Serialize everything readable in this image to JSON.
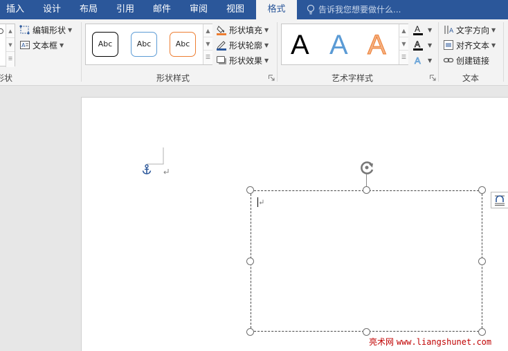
{
  "tabs": [
    {
      "label": "插入",
      "active": false
    },
    {
      "label": "设计",
      "active": false
    },
    {
      "label": "布局",
      "active": false
    },
    {
      "label": "引用",
      "active": false
    },
    {
      "label": "邮件",
      "active": false
    },
    {
      "label": "审阅",
      "active": false
    },
    {
      "label": "视图",
      "active": false
    },
    {
      "label": "格式",
      "active": true
    }
  ],
  "tell_me": {
    "placeholder": "告诉我您想要做什么..."
  },
  "groups": {
    "insert_shapes": {
      "label": "形状",
      "edit_shape": "编辑形状",
      "text_box": "文本框"
    },
    "shape_styles": {
      "label": "形状样式",
      "presets": [
        "Abc",
        "Abc",
        "Abc"
      ],
      "shape_fill": "形状填充",
      "shape_outline": "形状轮廓",
      "shape_effects": "形状效果"
    },
    "wordart_styles": {
      "label": "艺术字样式",
      "samples": [
        "A",
        "A",
        "A"
      ]
    },
    "text": {
      "label": "文本",
      "text_direction": "文字方向",
      "align_text": "对齐文本",
      "create_link": "创建链接"
    }
  },
  "colors": {
    "ribbon_blue": "#2b579a",
    "preset_black": "#000000",
    "preset_blue": "#5b9bd5",
    "preset_orange": "#ed7d31",
    "fill_orange": "#ed7d31"
  },
  "watermark": {
    "site": "亮术网",
    "url": "www.liangshunet.com"
  }
}
